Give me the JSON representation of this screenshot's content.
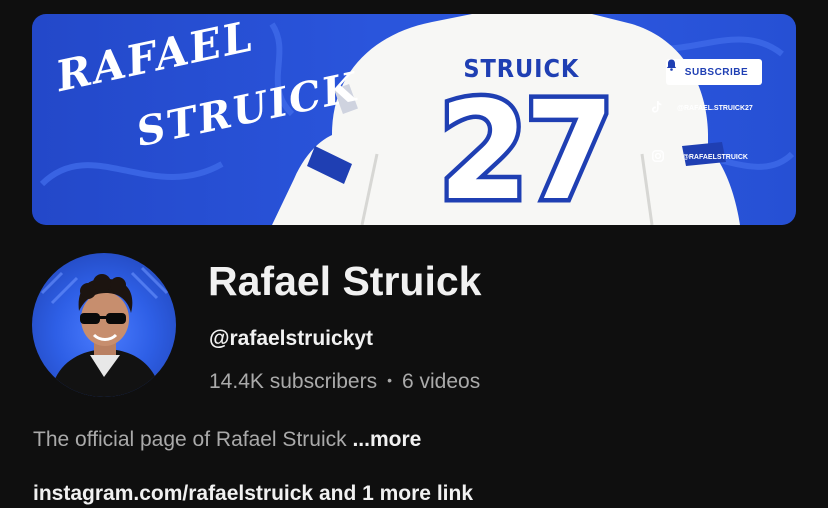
{
  "banner": {
    "first_name": "RAFAEL",
    "last_name": "STRUICK",
    "jersey_name": "STRUICK",
    "jersey_number": "27",
    "subscribe_label": "SUBSCRIBE",
    "tiktok_handle": "@RAFAEL.STRUICK27",
    "instagram_handle": "@RAFAELSTRUICK",
    "icons": [
      "bell-icon",
      "tiktok-icon",
      "instagram-icon"
    ],
    "colors": {
      "background": "#2a55dc",
      "jersey": "#f7f7f5",
      "jersey_print": "#1f3fb3"
    }
  },
  "channel": {
    "title": "Rafael Struick",
    "handle": "@rafaelstruickyt",
    "subscribers": "14.4K subscribers",
    "separator": "•",
    "videos": "6 videos",
    "description": "The official page of Rafael Struick",
    "more_label": "...more",
    "links_text": "instagram.com/rafaelstruick and 1 more link"
  }
}
